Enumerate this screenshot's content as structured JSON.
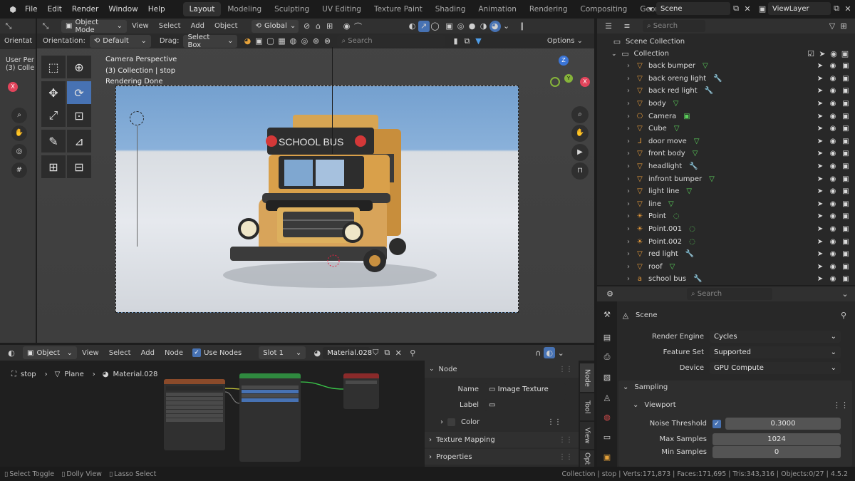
{
  "topmenu": [
    "File",
    "Edit",
    "Render",
    "Window",
    "Help"
  ],
  "workspaces": [
    "Layout",
    "Modeling",
    "Sculpting",
    "UV Editing",
    "Texture Paint",
    "Shading",
    "Animation",
    "Rendering",
    "Compositing",
    "Geometry Node"
  ],
  "scene_name": "Scene",
  "viewlayer_name": "ViewLayer",
  "viewport": {
    "mode": "Object Mode",
    "menus": [
      "View",
      "Select",
      "Add",
      "Object"
    ],
    "transform": "Global",
    "orientation_label": "Orientation:",
    "orientation_value": "Default",
    "drag_label": "Drag:",
    "drag_value": "Select Box",
    "search_placeholder": "Search",
    "options": "Options",
    "overlay_line1": "Camera Perspective",
    "overlay_line2": "(3) Collection | stop",
    "overlay_line3": "Rendering Done",
    "left_peek_1": "Orientat",
    "left_peek_2": "User Per",
    "left_peek_3": "(3) Colle",
    "bus_sign": "SCHOOL BUS",
    "gizmo_z": "Z",
    "gizmo_y": "Y",
    "gizmo_x": "X"
  },
  "outliner": {
    "search_placeholder": "Search",
    "scene_collection": "Scene Collection",
    "collection": "Collection",
    "items": [
      {
        "name": "back bumper",
        "icon": "mesh-icon",
        "extra": "mesh-data-icon"
      },
      {
        "name": "back oreng light",
        "icon": "mesh-icon",
        "extra": "modifier-icon"
      },
      {
        "name": "back red light",
        "icon": "mesh-icon",
        "extra": "modifier-icon"
      },
      {
        "name": "body",
        "icon": "mesh-icon",
        "extra": "mesh-data-icon"
      },
      {
        "name": "Camera",
        "icon": "camera-icon",
        "extra": "camera-data-icon"
      },
      {
        "name": "Cube",
        "icon": "mesh-icon",
        "extra": "mesh-data-icon"
      },
      {
        "name": "door move",
        "icon": "empty-icon",
        "extra": "object-icon"
      },
      {
        "name": "front body",
        "icon": "mesh-icon",
        "extra": "mesh-data-icon"
      },
      {
        "name": "headlight",
        "icon": "mesh-icon",
        "extra": "modifier-icon"
      },
      {
        "name": "infront bumper",
        "icon": "mesh-icon",
        "extra": "mesh-data-icon"
      },
      {
        "name": "light line",
        "icon": "mesh-icon",
        "extra": "mesh-data-icon"
      },
      {
        "name": "line",
        "icon": "mesh-icon",
        "extra": "mesh-data-icon"
      },
      {
        "name": "Point",
        "icon": "light-icon",
        "extra": "light-data-icon"
      },
      {
        "name": "Point.001",
        "icon": "light-icon",
        "extra": "light-data-icon"
      },
      {
        "name": "Point.002",
        "icon": "light-icon",
        "extra": "light-data-icon"
      },
      {
        "name": "red light",
        "icon": "mesh-icon",
        "extra": "modifier-icon"
      },
      {
        "name": "roof",
        "icon": "mesh-icon",
        "extra": "mesh-data-icon"
      },
      {
        "name": "school bus",
        "icon": "text-icon",
        "extra": "modifier-icon"
      }
    ]
  },
  "properties": {
    "search_placeholder": "Search",
    "scene_title": "Scene",
    "render_engine_label": "Render Engine",
    "render_engine_value": "Cycles",
    "feature_set_label": "Feature Set",
    "feature_set_value": "Supported",
    "device_label": "Device",
    "device_value": "GPU Compute",
    "sampling": "Sampling",
    "viewport_sub": "Viewport",
    "noise_threshold_label": "Noise Threshold",
    "noise_threshold_value": "0.3000",
    "max_samples_label": "Max Samples",
    "max_samples_value": "1024",
    "min_samples_label": "Min Samples",
    "min_samples_value": "0"
  },
  "node_editor": {
    "type": "Object",
    "menus": [
      "View",
      "Select",
      "Add",
      "Node"
    ],
    "use_nodes": "Use Nodes",
    "slot": "Slot 1",
    "material": "Material.028",
    "breadcrumb": [
      "stop",
      "Plane",
      "Material.028"
    ],
    "sidebar": {
      "node_header": "Node",
      "name_label": "Name",
      "name_value": "Image Texture",
      "label_label": "Label",
      "label_value": "",
      "color_label": "Color",
      "texture_mapping": "Texture Mapping",
      "properties": "Properties",
      "tabs": [
        "Node",
        "Tool",
        "View",
        "Opt"
      ]
    }
  },
  "statusbar": {
    "left": [
      "Select Toggle",
      "Dolly View",
      "Lasso Select"
    ],
    "right": "Collection | stop | Verts:171,873 | Faces:171,695 | Tris:343,316 | Objects:0/27 | 4.5.2"
  }
}
